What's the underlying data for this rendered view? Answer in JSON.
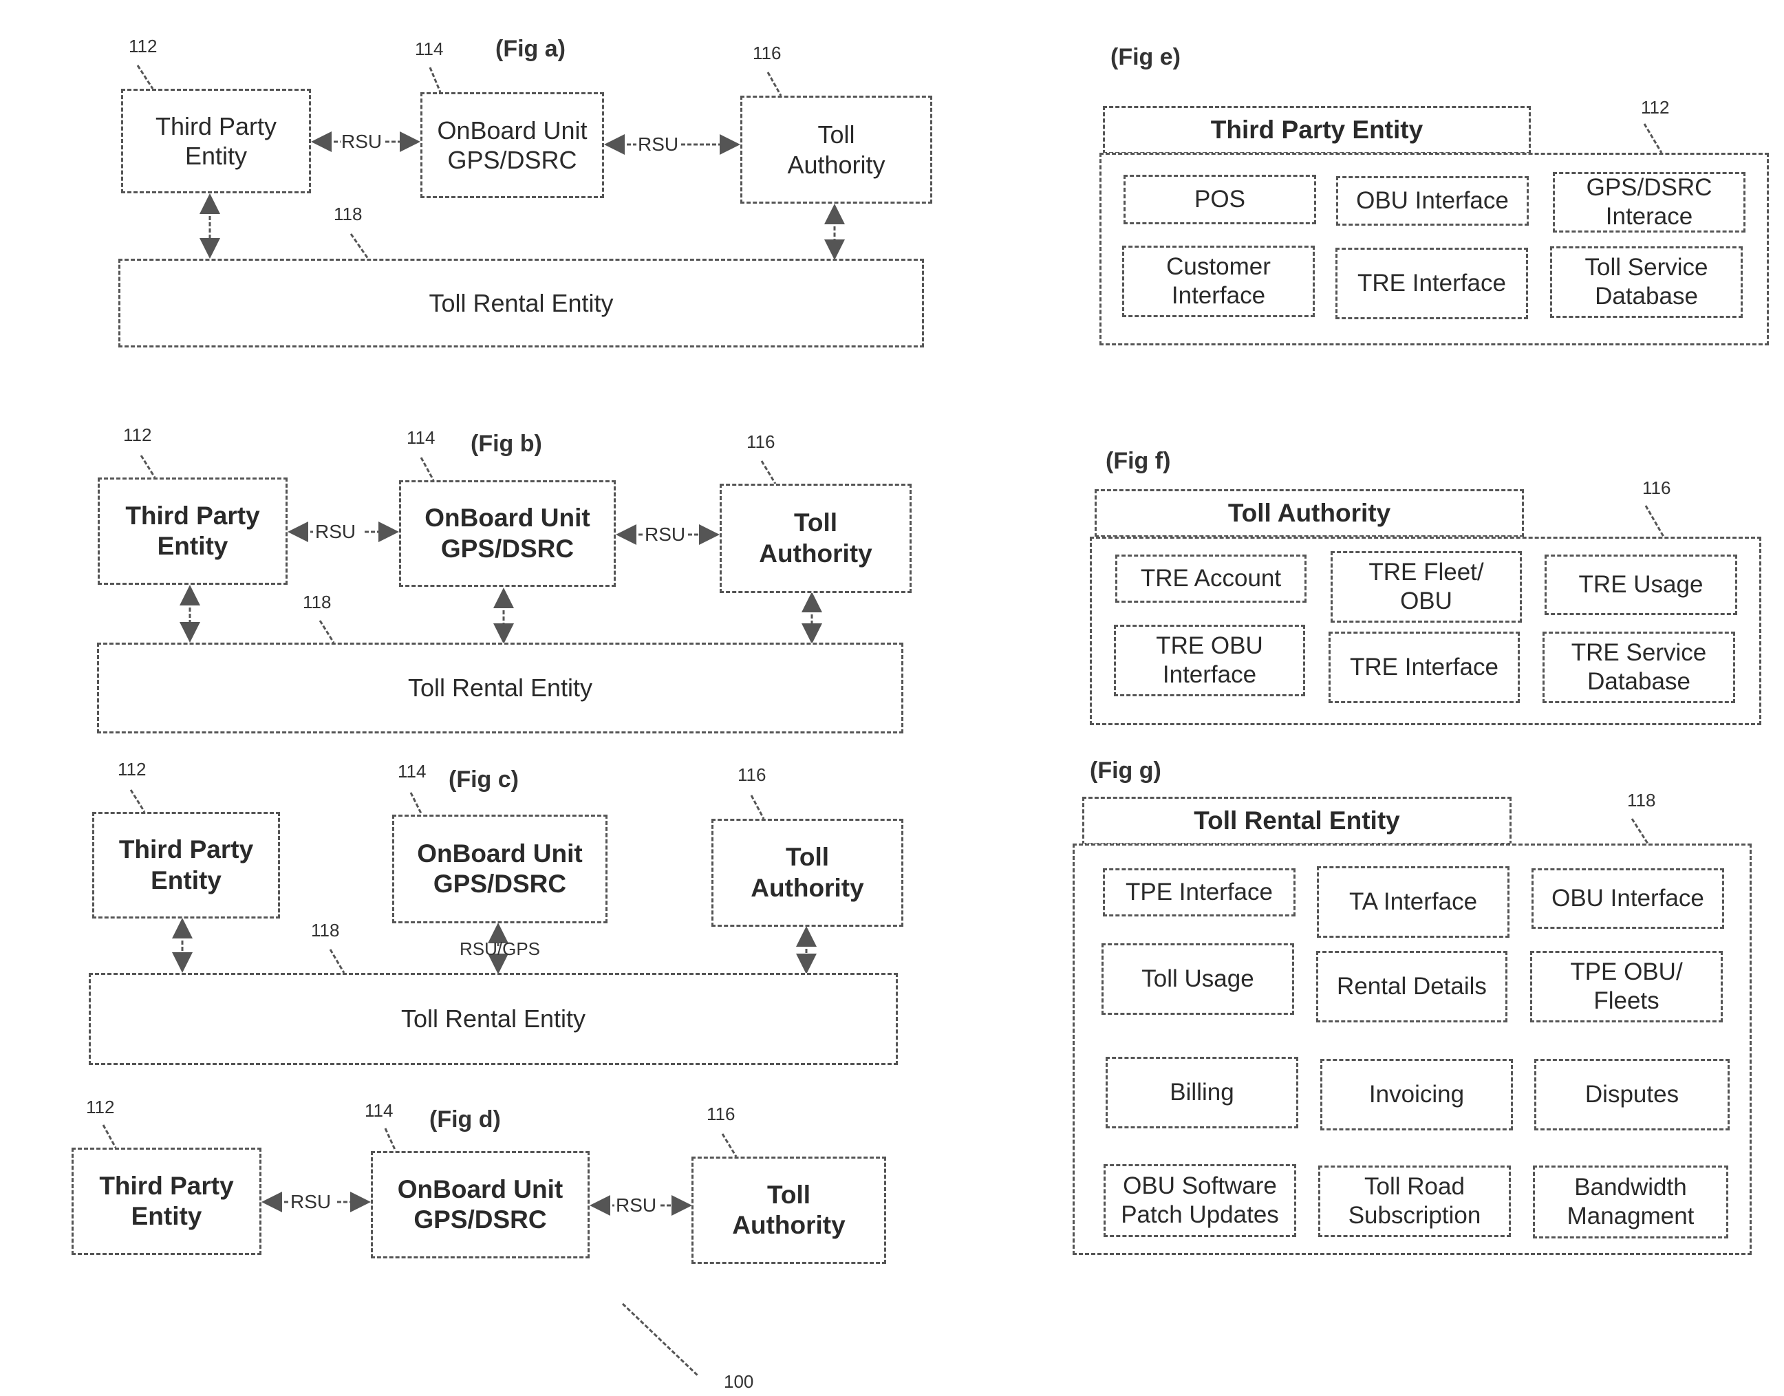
{
  "fig_a": {
    "label": "(Fig a)",
    "third_party": "Third Party\nEntity",
    "obu": "OnBoard Unit\nGPS/DSRC",
    "toll_authority": "Toll\nAuthority",
    "tre": "Toll Rental Entity",
    "link_left": "RSU",
    "link_right": "RSU",
    "ref_112": "112",
    "ref_114": "114",
    "ref_116": "116",
    "ref_118": "118"
  },
  "fig_b": {
    "label": "(Fig b)",
    "third_party": "Third Party\nEntity",
    "obu": "OnBoard Unit\nGPS/DSRC",
    "toll_authority": "Toll\nAuthority",
    "tre": "Toll Rental Entity",
    "link_left": "RSU",
    "link_right": "RSU",
    "ref_112": "112",
    "ref_114": "114",
    "ref_116": "116",
    "ref_118": "118"
  },
  "fig_c": {
    "label": "(Fig c)",
    "third_party": "Third Party\nEntity",
    "obu": "OnBoard Unit\nGPS/DSRC",
    "toll_authority": "Toll\nAuthority",
    "tre": "Toll Rental Entity",
    "link_obu_tre": "RSU/GPS",
    "ref_112": "112",
    "ref_114": "114",
    "ref_116": "116",
    "ref_118": "118"
  },
  "fig_d": {
    "label": "(Fig d)",
    "third_party": "Third Party\nEntity",
    "obu": "OnBoard Unit\nGPS/DSRC",
    "toll_authority": "Toll\nAuthority",
    "link_left": "RSU",
    "link_right": "RSU",
    "ref_112": "112",
    "ref_114": "114",
    "ref_116": "116"
  },
  "system_ref": "100",
  "fig_e": {
    "label": "(Fig e)",
    "title": "Third Party Entity",
    "ref": "112",
    "items": [
      "POS",
      "OBU Interface",
      "GPS/DSRC\nInterace",
      "Customer\nInterface",
      "TRE Interface",
      "Toll Service\nDatabase"
    ]
  },
  "fig_f": {
    "label": "(Fig f)",
    "title": "Toll Authority",
    "ref": "116",
    "items": [
      "TRE Account",
      "TRE Fleet/\nOBU",
      "TRE Usage",
      "TRE OBU\nInterface",
      "TRE Interface",
      "TRE Service\nDatabase"
    ]
  },
  "fig_g": {
    "label": "(Fig g)",
    "title": "Toll Rental Entity",
    "ref": "118",
    "items": [
      "TPE Interface",
      "TA Interface",
      "OBU Interface",
      "Toll Usage",
      "Rental Details",
      "TPE OBU/\nFleets",
      "Billing",
      "Invoicing",
      "Disputes",
      "OBU Software\nPatch Updates",
      "Toll Road\nSubscription",
      "Bandwidth\nManagment"
    ]
  }
}
